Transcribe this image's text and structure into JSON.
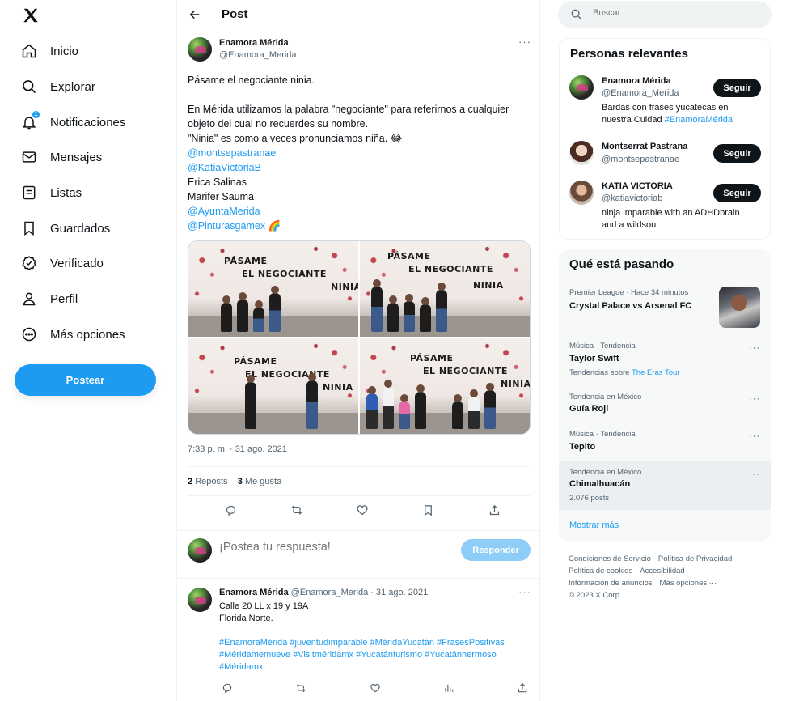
{
  "nav": {
    "items": [
      {
        "label": "Inicio",
        "icon": "home-icon"
      },
      {
        "label": "Explorar",
        "icon": "search-icon"
      },
      {
        "label": "Notificaciones",
        "icon": "bell-icon",
        "badge": "1"
      },
      {
        "label": "Mensajes",
        "icon": "mail-icon"
      },
      {
        "label": "Listas",
        "icon": "list-icon"
      },
      {
        "label": "Guardados",
        "icon": "bookmark-icon"
      },
      {
        "label": "Verificado",
        "icon": "verified-icon"
      },
      {
        "label": "Perfil",
        "icon": "person-icon"
      },
      {
        "label": "Más opciones",
        "icon": "more-circle-icon"
      }
    ],
    "post_button": "Postear"
  },
  "main": {
    "title": "Post",
    "tweet": {
      "author_name": "Enamora Mérida",
      "author_handle": "@Enamora_Merida",
      "lines": [
        {
          "text": "Pásame el negociante ninia.",
          "link": false
        },
        {
          "text": "",
          "link": false
        },
        {
          "text": "En Mérida utilizamos la palabra \"negociante\" para referirnos a cualquier",
          "link": false
        },
        {
          "text": "objeto del cual no recuerdes su nombre.",
          "link": false
        },
        {
          "text": "\"Ninia\" es como a veces pronunciamos niña. 😂",
          "link": false
        },
        {
          "text": "@montsepastranae",
          "link": true
        },
        {
          "text": "@KatiaVictoriaB",
          "link": true
        },
        {
          "text": "Erica Salinas",
          "link": false
        },
        {
          "text": "Marifer Sauma",
          "link": false
        },
        {
          "text": "@AyuntaMerida",
          "link": true
        },
        {
          "text": "@Pinturasgamex 🌈",
          "link": true
        }
      ],
      "photo_wall_text": [
        "PÁSAME",
        "EL NEGOCIANTE",
        "NINIA"
      ],
      "timestamp": "7:33 p. m. · 31 ago. 2021",
      "reposts_count": "2",
      "reposts_label": "Reposts",
      "likes_count": "3",
      "likes_label": "Me gusta"
    },
    "reply_placeholder": "¡Postea tu respuesta!",
    "reply_button": "Responder",
    "reply_tweet": {
      "author_name": "Enamora Mérida",
      "meta": "@Enamora_Merida · 31 ago. 2021",
      "lines": [
        {
          "text": "Calle 20 LL x 19 y 19A",
          "link": false
        },
        {
          "text": "Florida Norte.",
          "link": false
        },
        {
          "text": "",
          "link": false
        },
        {
          "text": "#EnamoraMérida #juventudimparable #MéridaYucatán #FrasesPositivas",
          "link": true
        },
        {
          "text": "#Méridamemueve #Visitméridamx #Yucatánturismo #Yucatánhermoso",
          "link": true
        },
        {
          "text": "#Méridamx",
          "link": true
        }
      ]
    }
  },
  "right": {
    "search_placeholder": "Buscar",
    "relevant": {
      "title": "Personas relevantes",
      "follow_label": "Seguir",
      "people": [
        {
          "name": "Enamora Mérida",
          "handle": "@Enamora_Merida",
          "bio_1": "Bardas con frases yucatecas en",
          "bio_2_text": "nuestra Cuidad ",
          "bio_2_link": "#EnamoraMérida"
        },
        {
          "name": "Montserrat Pastrana",
          "handle": "@montsepastranae"
        },
        {
          "name": "KATIA VICTORIA",
          "handle": "@katiavictoriab",
          "bio_1": "ninja imparable with an ADHDbrain",
          "bio_2_text": "and a wildsoul",
          "bio_2_link": ""
        }
      ]
    },
    "trends": {
      "title": "Qué está pasando",
      "items": [
        {
          "meta": "Premier League · Hace 34 minutos",
          "title": "Crystal Palace vs Arsenal FC"
        },
        {
          "meta": "Música · Tendencia",
          "title": "Taylor Swift",
          "sub": "Tendencias sobre ",
          "sub_link": "The Eras Tour"
        },
        {
          "meta": "Tendencia en México",
          "title": "Guía Roji"
        },
        {
          "meta": "Música · Tendencia",
          "title": "Tepito"
        },
        {
          "meta": "Tendencia en México",
          "title": "Chimalhuacán",
          "sub": "2.076 posts"
        }
      ],
      "show_more": "Mostrar más"
    },
    "footer": {
      "links": [
        "Condiciones de Servicio",
        "Política de Privacidad",
        "Política de cookies",
        "Accesibilidad",
        "Información de anuncios",
        "Más opciones ···"
      ],
      "copyright": "© 2023 X Corp."
    }
  },
  "colors": {
    "accent": "#1d9bf0",
    "text": "#0f1419",
    "muted": "#536471"
  }
}
